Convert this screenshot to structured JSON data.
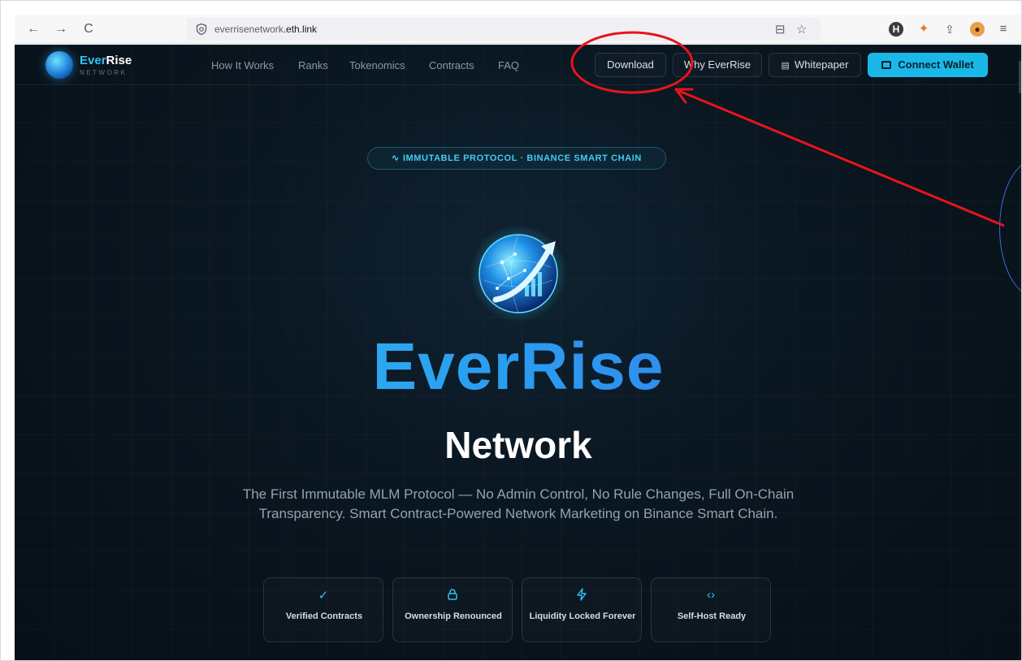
{
  "browser": {
    "back": "←",
    "forward": "→",
    "reload": "C",
    "url_host": "everrisenetwork",
    "url_bold": ".eth.link",
    "extensions": [
      "H",
      "M",
      "share",
      "avatar",
      "menu"
    ]
  },
  "site": {
    "logo_ever": "Ever",
    "logo_rise": "Rise",
    "logo_sub": "NETWORK",
    "nav": [
      "How It Works",
      "Ranks",
      "Tokenomics",
      "Contracts",
      "FAQ"
    ],
    "download": "Download",
    "why": "Why EverRise",
    "whitepaper": "Whitepaper",
    "connect": "Connect Wallet"
  },
  "hero": {
    "pill": "IMMUTABLE PROTOCOL · BINANCE SMART CHAIN",
    "title": "EverRise",
    "subtitle": "Network",
    "description": "The First Immutable MLM Protocol — No Admin Control, No Rule Changes, Full On-Chain Transparency. Smart Contract-Powered Network Marketing on Binance Smart Chain.",
    "features": [
      {
        "icon": "check-icon",
        "label": "Verified Contracts"
      },
      {
        "icon": "lock-icon",
        "label": "Ownership Renounced"
      },
      {
        "icon": "bolt-icon",
        "label": "Liquidity Locked Forever"
      },
      {
        "icon": "code-icon",
        "label": "Self-Host Ready"
      }
    ]
  },
  "colors": {
    "accent": "#2fc3f5",
    "background": "#0a1620",
    "annotation": "#e8141b"
  }
}
